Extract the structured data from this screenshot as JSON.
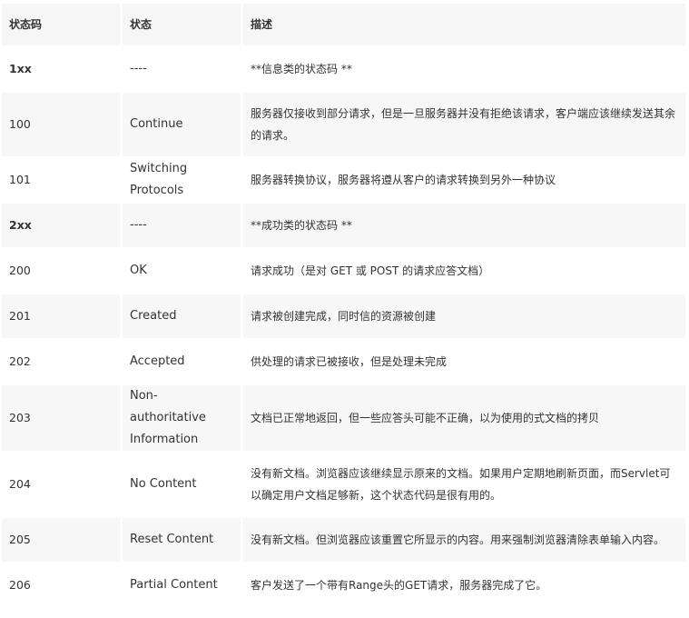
{
  "table": {
    "headers": [
      "状态码",
      "状态",
      "描述"
    ],
    "rows": [
      {
        "code": "1xx",
        "status": "----",
        "desc": "**信息类的状态码 **",
        "bold": true
      },
      {
        "code": "100",
        "status": "Continue",
        "desc": "服务器仅接收到部分请求，但是一旦服务器并没有拒绝该请求，客户端应该继续发送其余的请求。"
      },
      {
        "code": "101",
        "status": "Switching Protocols",
        "desc": "服务器转换协议，服务器将遵从客户的请求转换到另外一种协议"
      },
      {
        "code": "2xx",
        "status": "----",
        "desc": "**成功类的状态码 **",
        "bold": true
      },
      {
        "code": "200",
        "status": "OK",
        "desc": "请求成功（是对 GET 或 POST 的请求应答文档）"
      },
      {
        "code": "201",
        "status": "Created",
        "desc": "请求被创建完成，同时信的资源被创建"
      },
      {
        "code": "202",
        "status": "Accepted",
        "desc": "供处理的请求已被接收，但是处理未完成"
      },
      {
        "code": "203",
        "status": "Non-authoritative Information",
        "desc": "文档已正常地返回，但一些应答头可能不正确，以为使用的式文档的拷贝"
      },
      {
        "code": "204",
        "status": "No Content",
        "desc": "没有新文档。浏览器应该继续显示原来的文档。如果用户定期地刷新页面，而Servlet可以确定用户文档足够新，这个状态代码是很有用的。"
      },
      {
        "code": "205",
        "status": "Reset Content",
        "desc": "没有新文档。但浏览器应该重置它所显示的内容。用来强制浏览器清除表单输入内容。"
      },
      {
        "code": "206",
        "status": "Partial Content",
        "desc": "客户发送了一个带有Range头的GET请求，服务器完成了它。"
      }
    ]
  }
}
